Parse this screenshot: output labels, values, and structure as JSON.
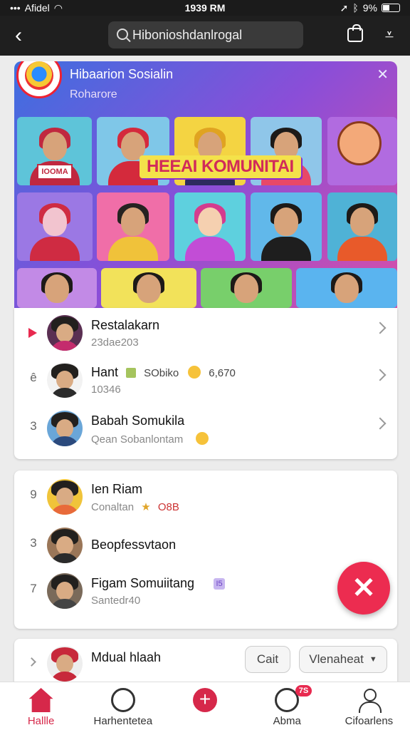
{
  "status_bar": {
    "carrier": "Afidel",
    "time": "1939 RM",
    "battery": "9%"
  },
  "header": {
    "search_text": "Hibonioshdanlrogal"
  },
  "banner": {
    "title": "Hibaarion Sosialin",
    "subtitle": "Roharore",
    "headline": "HEEAI KOMUNITAI",
    "tile_sign": "IOOMA",
    "colors": [
      "#3d6fe0",
      "#8a4ed8",
      "#d94fa7"
    ]
  },
  "list1": [
    {
      "rank": "",
      "name": "Restalakarn",
      "sub": "23dae203"
    },
    {
      "rank": "ê",
      "name": "Hant",
      "tag": "SObiko",
      "count": "6,670",
      "sub": "10346"
    },
    {
      "rank": "3",
      "name": "Babah Somukila",
      "sub": "Qean Sobanlontam"
    }
  ],
  "list2": [
    {
      "rank": "9",
      "name": "Ien Riam",
      "sub": "Conaltan",
      "extra": "O8B"
    },
    {
      "rank": "3",
      "name": "Beopfessvtaon",
      "sub": ""
    },
    {
      "rank": "7",
      "name": "Figam Somuiitang",
      "sub": "Santedr40",
      "badge": "I5"
    }
  ],
  "list3": {
    "name": "Mdual hlaah",
    "btn_left": "Cait",
    "btn_right": "Vlenaheat"
  },
  "fab": {
    "icon": "close-icon",
    "color": "#ec2c50"
  },
  "nav": [
    {
      "label": "Hallle"
    },
    {
      "label": "Harhentetea"
    },
    {
      "label": ""
    },
    {
      "label": "Abma",
      "badge": "7S"
    },
    {
      "label": "Cifoarlens"
    }
  ],
  "accent": "#d6284a"
}
